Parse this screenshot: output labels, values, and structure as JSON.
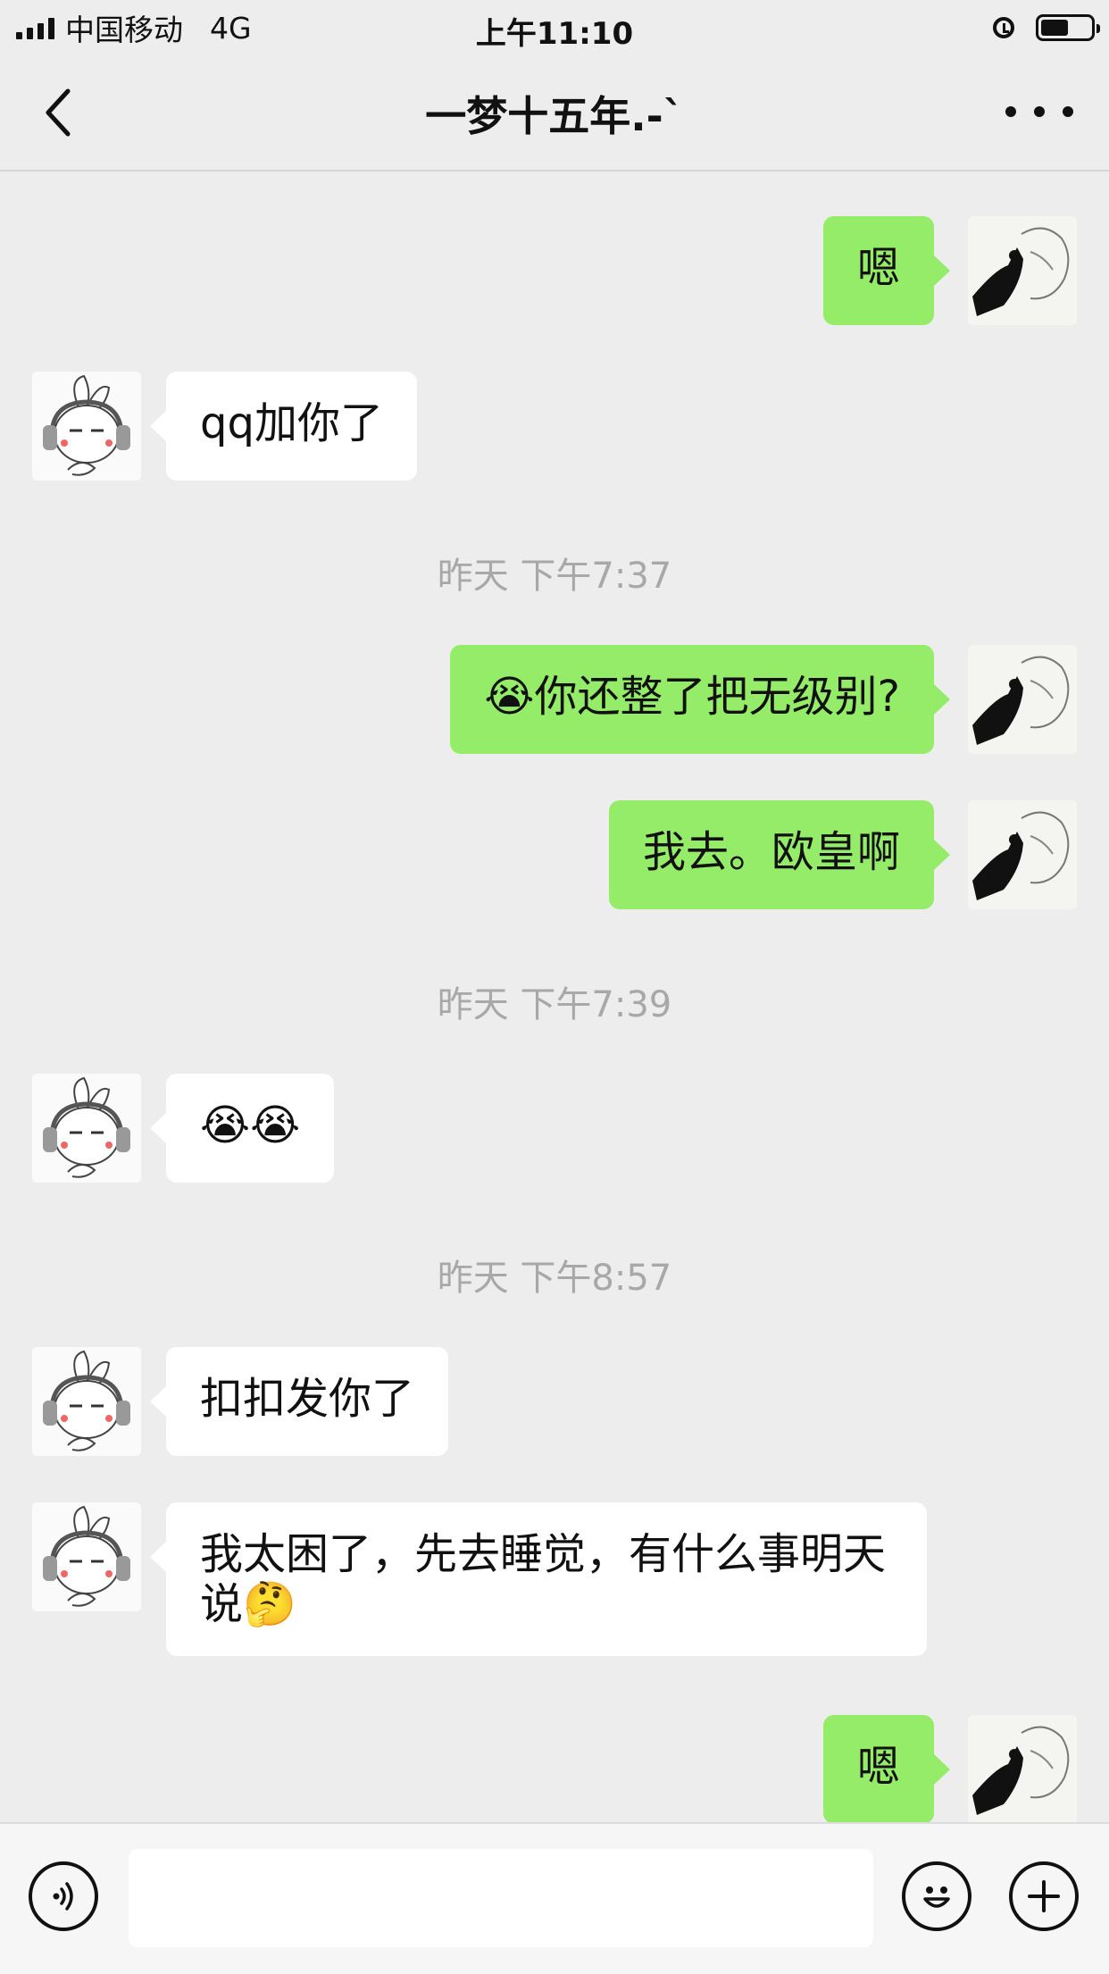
{
  "status_bar": {
    "carrier": "中国移动",
    "network": "4G",
    "time": "上午11:10"
  },
  "nav": {
    "title": "一梦十五年.-`"
  },
  "messages": [
    {
      "type": "message",
      "side": "out",
      "text": "嗯"
    },
    {
      "type": "message",
      "side": "in",
      "text": "qq加你了"
    },
    {
      "type": "timestamp",
      "text": "昨天 下午7:37"
    },
    {
      "type": "message",
      "side": "out",
      "text": "😭你还整了把无级别?"
    },
    {
      "type": "message",
      "side": "out",
      "text": "我去。欧皇啊"
    },
    {
      "type": "timestamp",
      "text": "昨天 下午7:39"
    },
    {
      "type": "message",
      "side": "in",
      "text": "😭😭"
    },
    {
      "type": "timestamp",
      "text": "昨天 下午8:57"
    },
    {
      "type": "message",
      "side": "in",
      "text": "扣扣发你了"
    },
    {
      "type": "message",
      "side": "in",
      "text": "我太困了，先去睡觉，有什么事明天说🤔"
    },
    {
      "type": "message",
      "side": "out",
      "text": "嗯"
    }
  ],
  "icons": {
    "back": "chevron-left-icon",
    "more": "more-dots-icon",
    "voice": "voice-icon",
    "emoji": "emoji-icon",
    "plus": "plus-icon"
  },
  "colors": {
    "background": "#ededed",
    "outgoing_bubble": "#95ec69",
    "incoming_bubble": "#ffffff",
    "timestamp": "#a8a8a8"
  }
}
